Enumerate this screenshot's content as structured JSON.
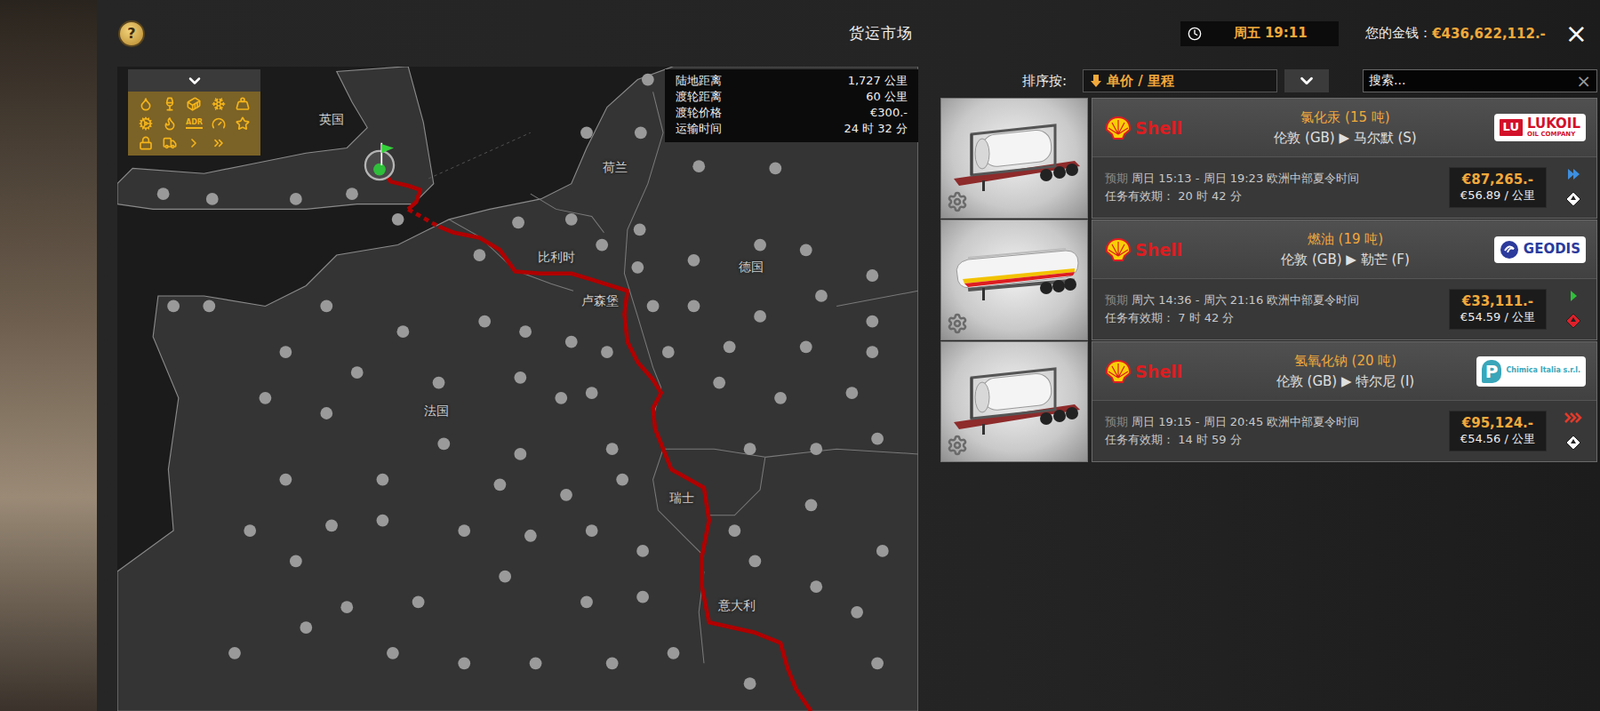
{
  "window": {
    "title": "货运市场",
    "help": "?",
    "time": "周五 19:11",
    "money_label": "您的金钱：",
    "money": "€436,622,112.-",
    "close": "×"
  },
  "filters": {
    "badge": "ADR"
  },
  "map": {
    "countries": [
      "英国",
      "荷兰",
      "比利时",
      "卢森堡",
      "德国",
      "法国",
      "瑞士",
      "意大利"
    ],
    "route_info": [
      {
        "label": "陆地距离",
        "value": "1,727 公里"
      },
      {
        "label": "渡轮距离",
        "value": "60 公里"
      },
      {
        "label": "渡轮价格",
        "value": "€300.-"
      },
      {
        "label": "运输时间",
        "value": "24 时 32 分"
      }
    ]
  },
  "sort": {
    "label": "排序按:",
    "value": "单价 / 里程"
  },
  "search": {
    "placeholder": "搜索...",
    "clear": "×"
  },
  "jobs": [
    {
      "trailer": "tank-container",
      "shipper": "Shell",
      "cargo": "氯化汞 (15 吨)",
      "route": "伦敦 (GB) ▶ 马尔默 (S)",
      "window_label": "预期",
      "window": "周日 15:13 - 周日 19:23 欧洲中部夏令时间",
      "valid_label": "任务有效期：",
      "valid": "20 时 42 分",
      "price": "€87,265.-",
      "per_km": "€56.89 / 公里",
      "urgency": {
        "kind": "fast",
        "color": "#3d8fe0"
      },
      "hazard_color": "#ffffff",
      "company": {
        "kind": "box-mark",
        "mark": "LU",
        "name": "LUKOIL",
        "sub": "OIL COMPANY",
        "color": "#d3102a"
      }
    },
    {
      "trailer": "tanker",
      "shipper": "Shell",
      "cargo": "燃油 (19 吨)",
      "route": "伦敦 (GB) ▶ 勒芒 (F)",
      "window_label": "预期",
      "window": "周六 14:36 - 周六 21:16 欧洲中部夏令时间",
      "valid_label": "任务有效期：",
      "valid": "7 时 42 分",
      "price": "€33,111.-",
      "per_km": "€54.59 / 公里",
      "urgency": {
        "kind": "normal",
        "color": "#2fbf3a"
      },
      "hazard_color": "#e0202a",
      "company": {
        "kind": "round-mark",
        "name": "GEODIS",
        "color": "#2b3a9c"
      }
    },
    {
      "trailer": "tank-container",
      "shipper": "Shell",
      "cargo": "氢氧化钠 (20 吨)",
      "route": "伦敦 (GB) ▶ 特尔尼 (I)",
      "window_label": "预期",
      "window": "周日 19:15 - 周日 20:45 欧洲中部夏令时间",
      "valid_label": "任务有效期：",
      "valid": "14 时 59 分",
      "price": "€95,124.-",
      "per_km": "€54.56 / 公里",
      "urgency": {
        "kind": "urgent",
        "color": "#e53a2a"
      },
      "hazard_color": "#ffffff",
      "company": {
        "kind": "letter-mark",
        "mark": "P",
        "name": "Chimica Italia s.r.l.",
        "color": "#3aa6b9"
      }
    }
  ]
}
